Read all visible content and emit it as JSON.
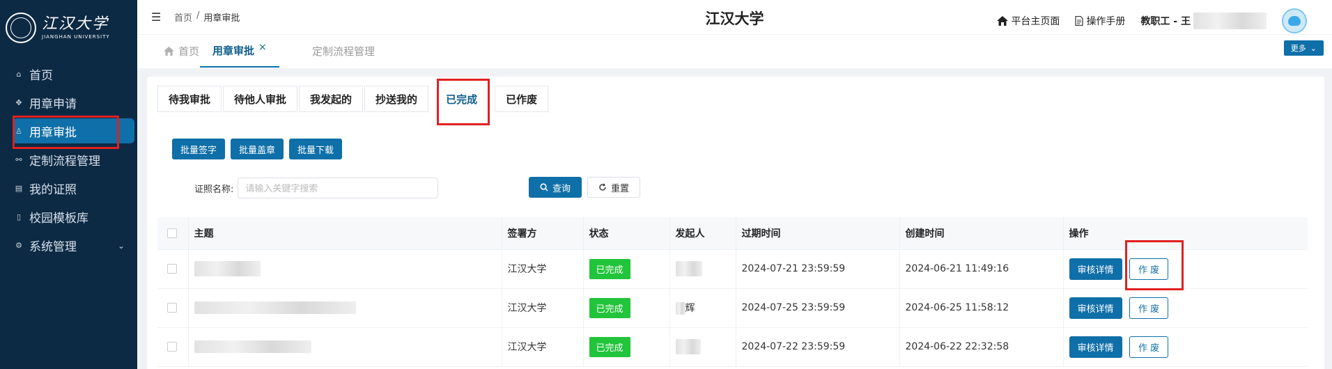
{
  "sidebar": {
    "logo_cn": "江汉大学",
    "logo_en": "JIANGHAN UNIVERSITY",
    "items": [
      {
        "label": "首页",
        "icon": "home-icon",
        "glyph": "⌂"
      },
      {
        "label": "用章申请",
        "icon": "stamp-apply-icon",
        "glyph": "✥"
      },
      {
        "label": "用章审批",
        "icon": "approve-icon",
        "glyph": "♙"
      },
      {
        "label": "定制流程管理",
        "icon": "workflow-icon",
        "glyph": "⚯"
      },
      {
        "label": "我的证照",
        "icon": "certificate-icon",
        "glyph": "▤"
      },
      {
        "label": "校园模板库",
        "icon": "template-icon",
        "glyph": "▯"
      },
      {
        "label": "系统管理",
        "icon": "settings-icon",
        "glyph": "⚙"
      }
    ],
    "chevron": "⌄"
  },
  "header": {
    "breadcrumb": [
      "首页",
      "/",
      "用章审批"
    ],
    "title": "江汉大学",
    "platform_home": "平台主页面",
    "manual": "操作手册",
    "user_prefix": "教职工 - 王"
  },
  "tabs": {
    "items": [
      "首页",
      "用章审批",
      "定制流程管理"
    ],
    "close": "×",
    "more": "更多",
    "more_chevron": "⌄"
  },
  "subtabs": [
    "待我审批",
    "待他人审批",
    "我发起的",
    "抄送我的",
    "已完成",
    "已作废"
  ],
  "actions": {
    "batch_sign": "批量签字",
    "batch_stamp": "批量盖章",
    "batch_download": "批量下载"
  },
  "search": {
    "label": "证照名称:",
    "placeholder": "请输入关键字搜索",
    "query": "查询",
    "reset": "重置"
  },
  "table": {
    "columns": [
      "主题",
      "签署方",
      "状态",
      "发起人",
      "过期时间",
      "创建时间",
      "操作"
    ],
    "rows": [
      {
        "signer": "江汉大学",
        "status": "已完成",
        "initiator": "",
        "expire": "2024-07-21 23:59:59",
        "created": "2024-06-21 11:49:16"
      },
      {
        "signer": "江汉大学",
        "status": "已完成",
        "initiator": "辉",
        "expire": "2024-07-25 23:59:59",
        "created": "2024-06-25 11:58:12"
      },
      {
        "signer": "江汉大学",
        "status": "已完成",
        "initiator": "",
        "expire": "2024-07-22 23:59:59",
        "created": "2024-06-22 22:32:58"
      }
    ],
    "detail_btn": "审核详情",
    "void_btn": "作 废"
  }
}
